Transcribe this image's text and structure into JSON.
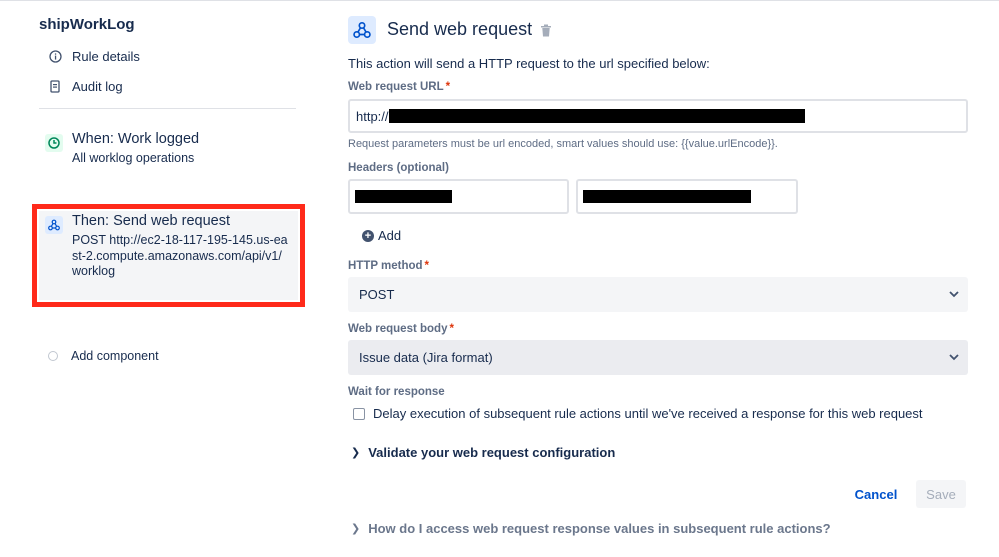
{
  "sidebar": {
    "rule_name": "shipWorkLog",
    "links": [
      {
        "label": "Rule details",
        "icon": "info-icon"
      },
      {
        "label": "Audit log",
        "icon": "document-icon"
      }
    ],
    "components": [
      {
        "title": "When: Work logged",
        "subtitle": "All worklog operations",
        "icon": "clock-icon"
      },
      {
        "title": "Then: Send web request",
        "subtitle": "POST http://ec2-18-117-195-145.us-east-2.compute.amazonaws.com/api/v1/worklog",
        "icon": "webhook-icon"
      }
    ],
    "add_component_label": "Add component"
  },
  "panel": {
    "title": "Send web request",
    "description": "This action will send a HTTP request to the url specified below:",
    "url": {
      "label": "Web request URL",
      "value_prefix": "http://"
    },
    "url_hint": "Request parameters must be url encoded, smart values should use: {{value.urlEncode}}.",
    "headers": {
      "label": "Headers (optional)",
      "add_label": "Add"
    },
    "http_method": {
      "label": "HTTP method",
      "value": "POST"
    },
    "body": {
      "label": "Web request body",
      "value": "Issue data (Jira format)"
    },
    "wait": {
      "label": "Wait for response",
      "checkbox_label": "Delay execution of subsequent rule actions until we've received a response for this web request",
      "checked": false
    },
    "validate_label": "Validate your web request configuration",
    "cancel_label": "Cancel",
    "save_label": "Save",
    "faq_label": "How do I access web request response values in subsequent rule actions?"
  },
  "colors": {
    "accent": "#0052cc",
    "highlight_border": "#ff2a1a",
    "required": "#de350b",
    "trigger_green": "#00875a"
  }
}
